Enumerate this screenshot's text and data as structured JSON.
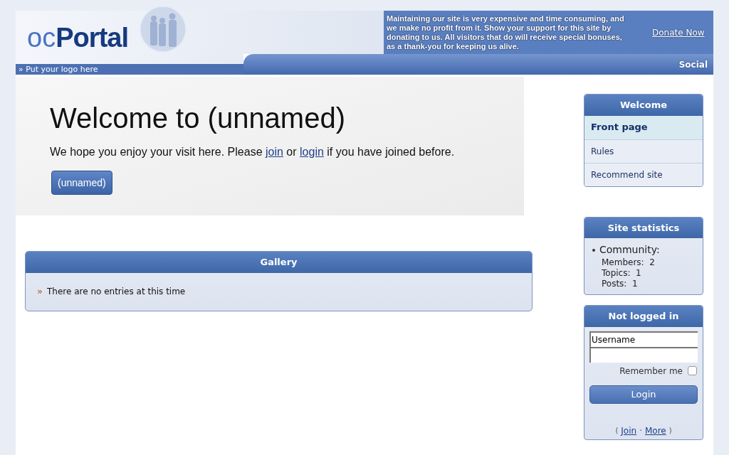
{
  "header": {
    "logo_light": "oc",
    "logo_bold": "Portal",
    "logo_hint_bullet": "»",
    "logo_hint": "Put your logo here",
    "donate_message": "Maintaining our site is very expensive and time consuming, and we make no profit from it. Show your support for this site by donating to us. All visitors that do will receive special bonuses, as a thank-you for keeping us alive.",
    "donate_link": "Donate Now",
    "zone_label": "Social"
  },
  "welcome": {
    "title": "Welcome to (unnamed)",
    "text_before": "We hope you enjoy your visit here. Please",
    "join_link": "join",
    "text_middle": "or",
    "login_link": "login",
    "text_after": "if you have joined before.",
    "button": "(unnamed)"
  },
  "gallery": {
    "title": "Gallery",
    "bullet": "»",
    "empty_text": "There are no entries at this time"
  },
  "menu": {
    "title": "Welcome",
    "items": [
      {
        "label": "Front page",
        "selected": true
      },
      {
        "label": "Rules",
        "selected": false
      },
      {
        "label": "Recommend site",
        "selected": false
      }
    ]
  },
  "stats": {
    "title": "Site statistics",
    "heading": "Community:",
    "rows": [
      "Members:  2",
      "Topics:  1",
      "Posts:  1"
    ]
  },
  "login": {
    "title": "Not logged in",
    "username": "Username",
    "remember_label": "Remember me",
    "remember_checked": false,
    "button": "Login",
    "paren_open": "(",
    "join_link": "Join",
    "separator": "·",
    "more_link": "More",
    "paren_close": ")"
  }
}
